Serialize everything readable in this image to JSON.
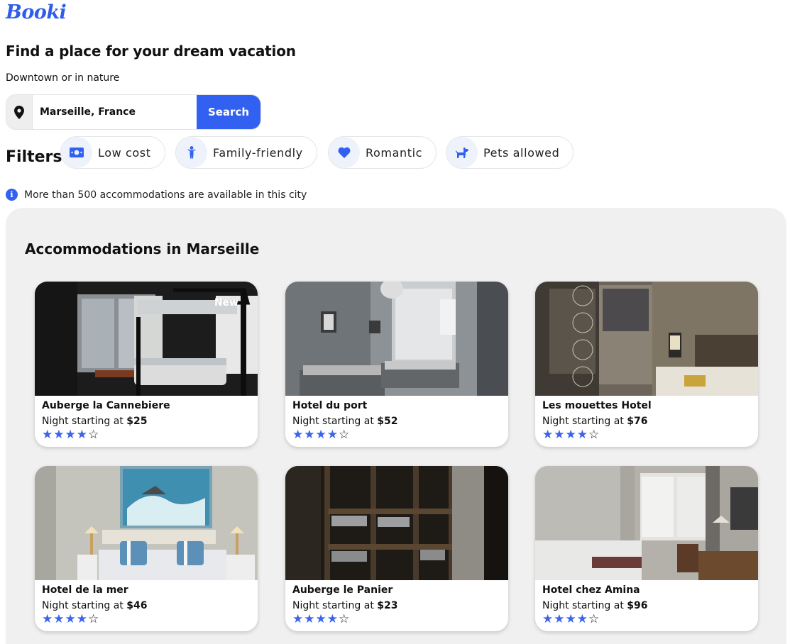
{
  "brand": {
    "logo": "Booki"
  },
  "hero": {
    "title": "Find a place for your dream vacation",
    "subtitle": "Downtown or in nature"
  },
  "search": {
    "value": "Marseille, France",
    "button_label": "Search",
    "icon": "map-marker-icon"
  },
  "filters": {
    "label": "Filters",
    "items": [
      {
        "label": "Low cost",
        "icon": "money-icon"
      },
      {
        "label": "Family-friendly",
        "icon": "child-icon"
      },
      {
        "label": "Romantic",
        "icon": "heart-icon"
      },
      {
        "label": "Pets allowed",
        "icon": "dog-icon"
      }
    ]
  },
  "info": {
    "text": "More than 500 accommodations are available in this city",
    "icon": "info-icon"
  },
  "accommodations": {
    "title": "Accommodations in Marseille",
    "price_prefix": "Night starting at",
    "items": [
      {
        "name": "Auberge la Cannebiere",
        "price": "$25",
        "rating": 4,
        "max_rating": 5,
        "badge": "New"
      },
      {
        "name": "Hotel du port",
        "price": "$52",
        "rating": 4,
        "max_rating": 5
      },
      {
        "name": "Les mouettes Hotel",
        "price": "$76",
        "rating": 4,
        "max_rating": 5
      },
      {
        "name": "Hotel de la mer",
        "price": "$46",
        "rating": 4,
        "max_rating": 5
      },
      {
        "name": "Auberge le Panier",
        "price": "$23",
        "rating": 4,
        "max_rating": 5
      },
      {
        "name": "Hotel chez Amina",
        "price": "$96",
        "rating": 4,
        "max_rating": 5
      }
    ]
  },
  "colors": {
    "accent": "#3261f2",
    "star": "#3c63e8",
    "panel_bg": "#f0f0f0"
  }
}
